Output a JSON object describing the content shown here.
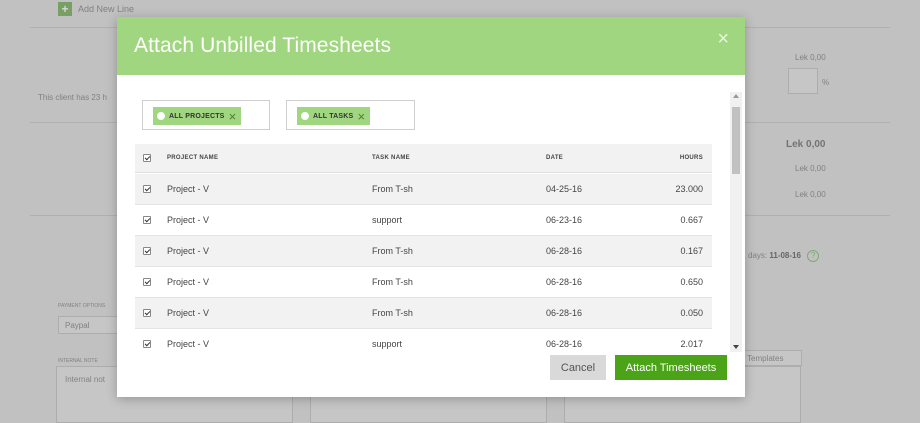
{
  "background": {
    "add_line_label": "Add New Line",
    "client_note": "This client has 23 h",
    "lek_values": [
      "Lek 0,00",
      "Lek 0,00",
      "Lek 0,00",
      "Lek 0,00"
    ],
    "lek_total": "Lek 0,00",
    "percent": "%",
    "due_days_label": "days:",
    "due_date": "11-08-16",
    "help_symbol": "?",
    "payment_options_label": "PAYMENT OPTIONS",
    "paypal_chip": "Paypal",
    "internal_note_label": "INTERNAL NOTE",
    "internal_note_placeholder": "Internal not",
    "templates_label": "Templates"
  },
  "modal": {
    "title": "Attach Unbilled Timesheets",
    "close_symbol": "×",
    "filters": [
      {
        "label": "ALL PROJECTS"
      },
      {
        "label": "ALL TASKS"
      }
    ],
    "remove_symbol": "×",
    "columns": {
      "project": "PROJECT NAME",
      "task": "TASK NAME",
      "date": "DATE",
      "hours": "HOURS"
    },
    "rows": [
      {
        "project": "Project - V",
        "task": "From T-sh",
        "date": "04-25-16",
        "hours": "23.000",
        "checked": true
      },
      {
        "project": "Project - V",
        "task": "support",
        "date": "06-23-16",
        "hours": "0.667",
        "checked": true
      },
      {
        "project": "Project - V",
        "task": "From T-sh",
        "date": "06-28-16",
        "hours": "0.167",
        "checked": true
      },
      {
        "project": "Project - V",
        "task": "From T-sh",
        "date": "06-28-16",
        "hours": "0.650",
        "checked": true
      },
      {
        "project": "Project - V",
        "task": "From T-sh",
        "date": "06-28-16",
        "hours": "0.050",
        "checked": true
      },
      {
        "project": "Project - V",
        "task": "support",
        "date": "06-28-16",
        "hours": "2.017",
        "checked": true
      }
    ],
    "buttons": {
      "cancel": "Cancel",
      "attach": "Attach Timesheets"
    },
    "colors": {
      "header": "#9fd67f",
      "primary_button": "#4ba417"
    }
  }
}
